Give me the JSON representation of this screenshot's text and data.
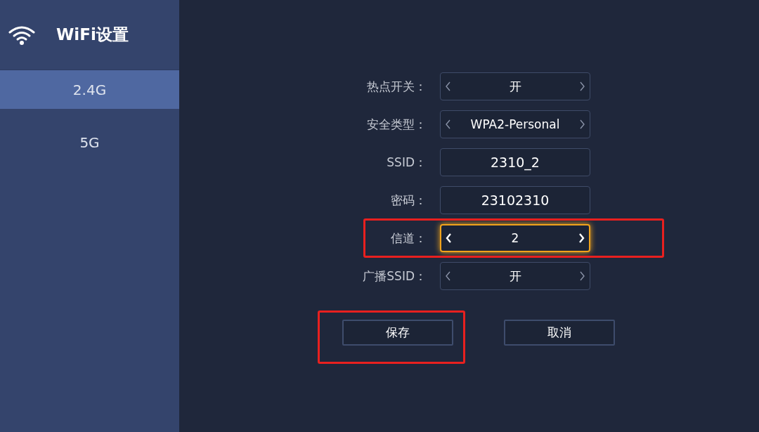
{
  "sidebar": {
    "title": "WiFi设置",
    "items": [
      {
        "label": "2.4G",
        "selected": true
      },
      {
        "label": "5G",
        "selected": false
      }
    ]
  },
  "form": {
    "rows": [
      {
        "kind": "selector",
        "label": "热点开关：",
        "value": "开",
        "focused": false,
        "highlighted": false
      },
      {
        "kind": "selector",
        "label": "安全类型：",
        "value": "WPA2-Personal",
        "focused": false,
        "highlighted": false
      },
      {
        "kind": "field",
        "label": "SSID：",
        "value": "2310_2",
        "focused": false,
        "highlighted": false
      },
      {
        "kind": "field",
        "label": "密码：",
        "value": "23102310",
        "focused": false,
        "highlighted": false
      },
      {
        "kind": "selector",
        "label": "信道：",
        "value": "2",
        "focused": true,
        "highlighted": true
      },
      {
        "kind": "selector",
        "label": "广播SSID：",
        "value": "开",
        "focused": false,
        "highlighted": false
      }
    ],
    "buttons": [
      {
        "label": "保存",
        "highlighted": true
      },
      {
        "label": "取消",
        "highlighted": false
      }
    ]
  }
}
